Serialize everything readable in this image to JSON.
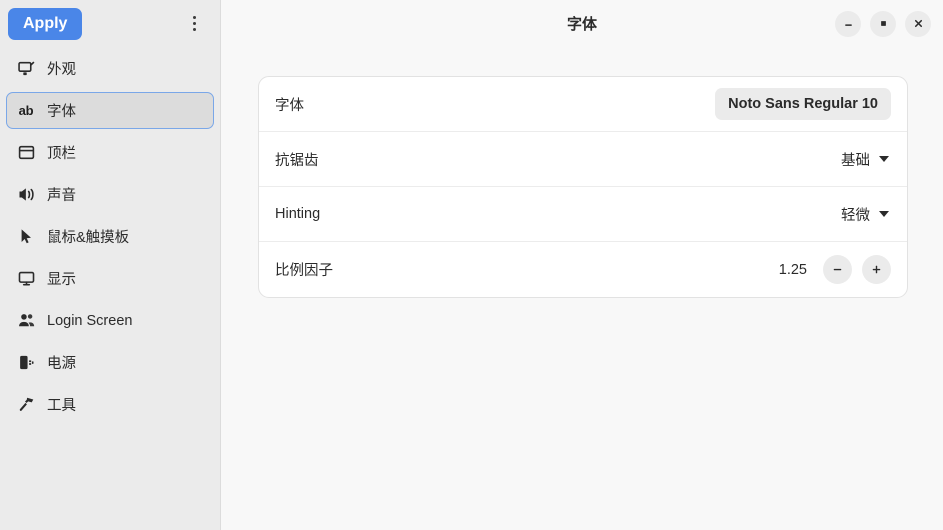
{
  "sidebar": {
    "apply_label": "Apply",
    "menu_icon": "kebab-menu-icon",
    "items": [
      {
        "label": "外观",
        "icon": "appearance-icon"
      },
      {
        "label": "字体",
        "icon": "font-ab-icon",
        "selected": true
      },
      {
        "label": "顶栏",
        "icon": "topbar-icon"
      },
      {
        "label": "声音",
        "icon": "sound-icon"
      },
      {
        "label": "鼠标&触摸板",
        "icon": "mouse-touchpad-icon"
      },
      {
        "label": "显示",
        "icon": "display-icon"
      },
      {
        "label": "Login Screen",
        "icon": "login-screen-icon"
      },
      {
        "label": "电源",
        "icon": "power-icon"
      },
      {
        "label": "工具",
        "icon": "tools-icon"
      }
    ]
  },
  "titlebar": {
    "title": "字体",
    "minimize_label": "minimize",
    "maximize_label": "maximize",
    "close_label": "close"
  },
  "settings": {
    "rows": [
      {
        "label": "字体",
        "control": "font-chip",
        "value": "Noto Sans Regular  10"
      },
      {
        "label": "抗锯齿",
        "control": "dropdown",
        "value": "基础"
      },
      {
        "label": "Hinting",
        "control": "dropdown",
        "value": "轻微"
      },
      {
        "label": "比例因子",
        "control": "spinner",
        "value": "1.25",
        "decrement_label": "−",
        "increment_label": "+"
      }
    ]
  },
  "colors": {
    "accent": "#4a86e8",
    "sidebar_bg": "#ebebeb",
    "content_bg": "#f8f8f8",
    "card_bg": "#ffffff",
    "selected_bg": "#dcdcdc",
    "selected_border": "#7aa7e8"
  }
}
